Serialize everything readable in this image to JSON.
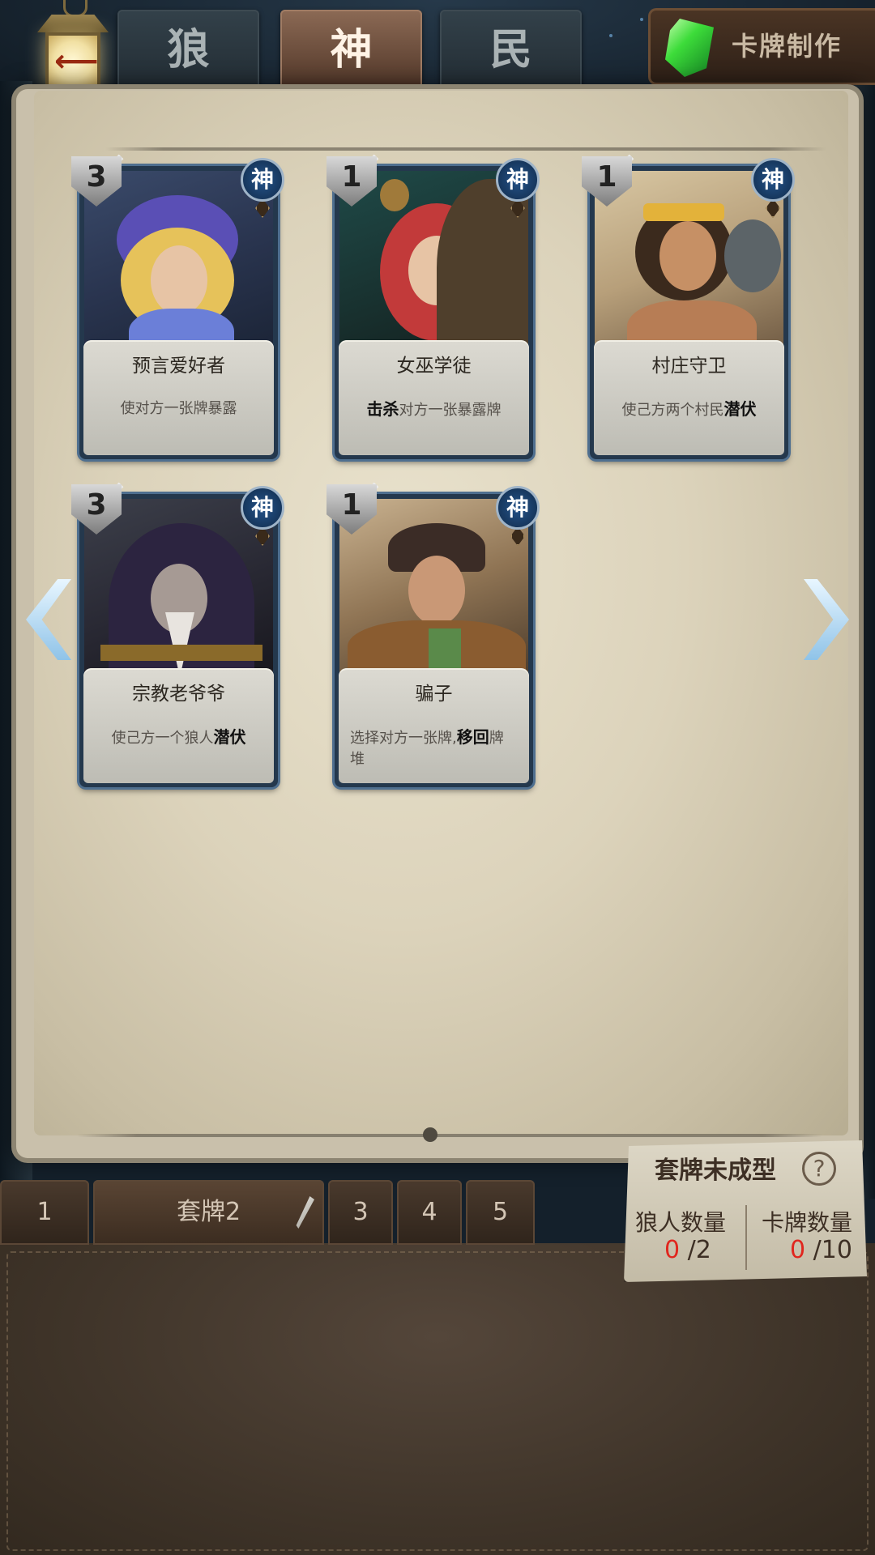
{
  "tabs": [
    {
      "label": "狼",
      "active": false
    },
    {
      "label": "神",
      "active": true
    },
    {
      "label": "民",
      "active": false
    }
  ],
  "card_make": {
    "label": "卡牌制作",
    "icon": "green-crystal-icon"
  },
  "back_icon": "back-arrow-icon",
  "cards": [
    {
      "cost": "3",
      "faction": "神",
      "name": "预言爱好者",
      "desc": "使对方一张牌暴露",
      "desc_bold": ""
    },
    {
      "cost": "1",
      "faction": "神",
      "name": "女巫学徒",
      "desc_bold_prefix": "击杀",
      "desc": "对方一张暴露牌"
    },
    {
      "cost": "1",
      "faction": "神",
      "name": "村庄守卫",
      "desc": "使己方两个村民",
      "desc_bold": "潜伏"
    },
    {
      "cost": "3",
      "faction": "神",
      "name": "宗教老爷爷",
      "desc": "使己方一个狼人",
      "desc_bold": "潜伏"
    },
    {
      "cost": "1",
      "faction": "神",
      "name": "骗子",
      "desc": "选择对方一张牌,",
      "desc_bold": "移回",
      "desc_suffix": "牌堆"
    }
  ],
  "deck_slots": [
    "1",
    "套牌2",
    "3",
    "4",
    "5"
  ],
  "deck_panel": {
    "status": "套牌未成型",
    "wolf_label": "狼人数量",
    "wolf_count": "0",
    "wolf_max": "/2",
    "card_label": "卡牌数量",
    "card_count": "0",
    "card_max": "/10"
  }
}
